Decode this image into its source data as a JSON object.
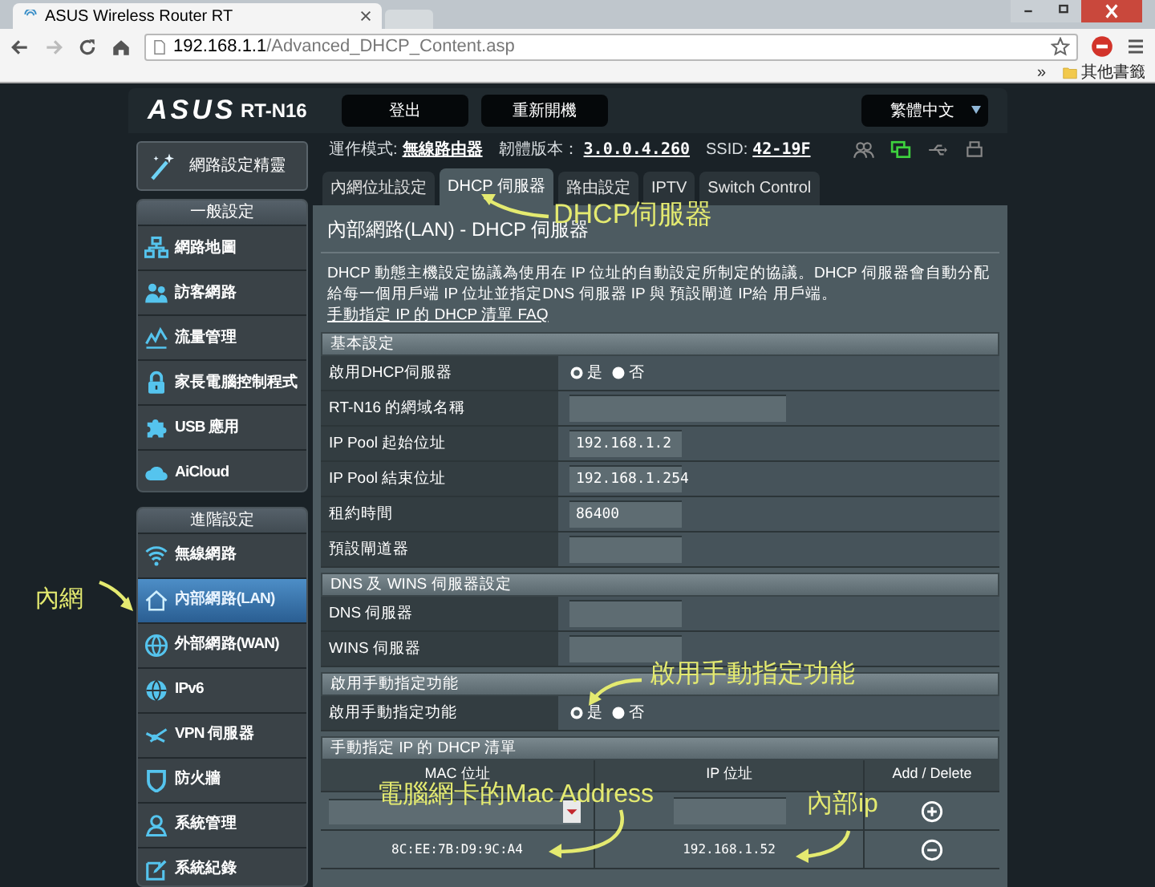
{
  "browser": {
    "tab_title": "ASUS Wireless Router RT",
    "url_host": "192.168.1.1",
    "url_path": "/Advanced_DHCP_Content.asp",
    "bookmarks_overflow": "»",
    "bookmarks_folder": "其他書籤"
  },
  "header": {
    "logo": "ASUS",
    "model": "RT-N16",
    "buttons": [
      "登出",
      "重新開機"
    ],
    "language": "繁體中文"
  },
  "info": [
    {
      "label": "運作模式:",
      "value": "無線路由器"
    },
    {
      "label": "韌體版本：",
      "value": "3.0.0.4.260"
    },
    {
      "label": "SSID:",
      "value": "42-19F"
    }
  ],
  "sidebar": {
    "quick_setup": "網路設定精靈",
    "sections": [
      {
        "title": "一般設定",
        "items": [
          {
            "label": "網路地圖",
            "selected": false
          },
          {
            "label": "訪客網路",
            "selected": false
          },
          {
            "label": "流量管理",
            "selected": false
          },
          {
            "label": "家長電腦控制程式",
            "selected": false
          },
          {
            "label": "USB 應用",
            "selected": false
          },
          {
            "label": "AiCloud",
            "selected": false
          }
        ]
      },
      {
        "title": "進階設定",
        "items": [
          {
            "label": "無線網路",
            "selected": false
          },
          {
            "label": "內部網路(LAN)",
            "selected": true
          },
          {
            "label": "外部網路(WAN)",
            "selected": false
          },
          {
            "label": "IPv6",
            "selected": false
          },
          {
            "label": "VPN 伺服器",
            "selected": false
          },
          {
            "label": "防火牆",
            "selected": false
          },
          {
            "label": "系統管理",
            "selected": false
          },
          {
            "label": "系統紀錄",
            "selected": false
          }
        ]
      }
    ]
  },
  "tabs": [
    {
      "label": "內網位址設定",
      "selected": false
    },
    {
      "label": "DHCP 伺服器",
      "selected": true
    },
    {
      "label": "路由設定",
      "selected": false
    },
    {
      "label": "IPTV",
      "selected": false
    },
    {
      "label": "Switch Control",
      "selected": false
    }
  ],
  "page": {
    "title": "內部網路(LAN) - DHCP 伺服器",
    "description": "DHCP 動態主機設定協議為使用在 IP 位址的自動設定所制定的協議。DHCP 伺服器會自動分配給每一個用戶端 IP 位址並指定DNS 伺服器 IP 與 預設閘道 IP給 用戶端。",
    "faq_link": "手動指定 IP 的 DHCP 清單 FAQ"
  },
  "sections": [
    {
      "title": "基本設定",
      "rows": [
        {
          "kind": "radio",
          "label": "啟用DHCP伺服器",
          "options": [
            {
              "label": "是",
              "selected": true
            },
            {
              "label": "否",
              "selected": false
            }
          ]
        },
        {
          "kind": "text",
          "label": "RT-N16 的網域名稱",
          "wide": true
        },
        {
          "kind": "text",
          "label": "IP Pool 起始位址",
          "value": "192.168.1.2"
        },
        {
          "kind": "text",
          "label": "IP Pool 結束位址",
          "value": "192.168.1.254"
        },
        {
          "kind": "text",
          "label": "租約時間",
          "value": "86400"
        },
        {
          "kind": "text",
          "label": "預設閘道器"
        }
      ]
    },
    {
      "title": "DNS 及 WINS 伺服器設定",
      "rows": [
        {
          "kind": "text",
          "label": "DNS 伺服器"
        },
        {
          "kind": "text",
          "label": "WINS 伺服器"
        }
      ]
    },
    {
      "title": "啟用手動指定功能",
      "rows": [
        {
          "kind": "radio",
          "label": "啟用手動指定功能",
          "options": [
            {
              "label": "是",
              "selected": true
            },
            {
              "label": "否",
              "selected": false
            }
          ]
        }
      ]
    }
  ],
  "manual_list": {
    "title": "手動指定 IP 的 DHCP 清單",
    "columns": [
      "MAC 位址",
      "IP 位址",
      "Add / Delete"
    ],
    "entries": [
      {
        "mac": "8C:EE:7B:D9:9C:A4",
        "ip": "192.168.1.52"
      }
    ]
  },
  "annotations": [
    {
      "text": "DHCP伺服器"
    },
    {
      "text": "內網"
    },
    {
      "text": "啟用手動指定功能"
    },
    {
      "text": "電腦網卡的Mac Address"
    },
    {
      "text": "內部ip"
    }
  ]
}
